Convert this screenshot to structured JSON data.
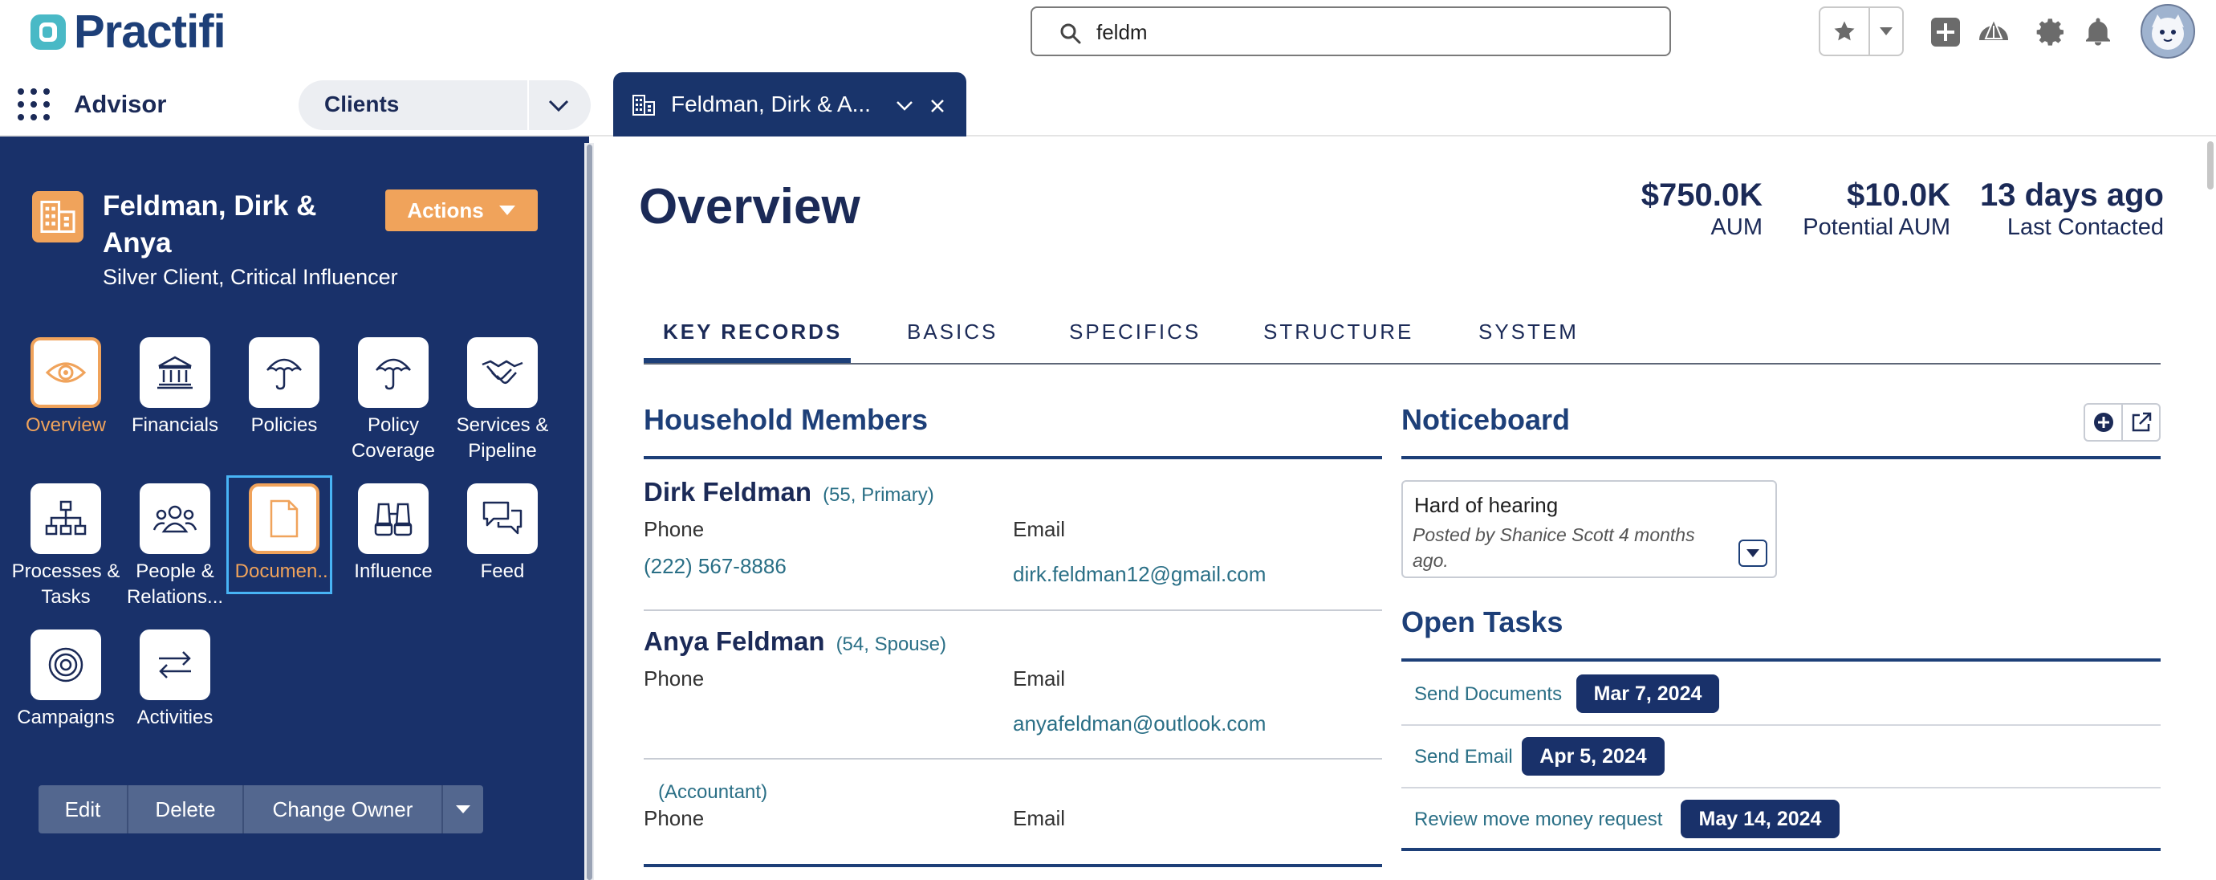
{
  "header": {
    "logo_text": "Practifi",
    "search": {
      "value": "feldm",
      "placeholder": ""
    }
  },
  "nav": {
    "app_name": "Advisor",
    "object_selector": "Clients",
    "active_tab": "Feldman, Dirk & A..."
  },
  "record": {
    "name": "Feldman, Dirk & Anya",
    "subtitle": "Silver Client, Critical Influencer",
    "actions_label": "Actions",
    "tiles": [
      {
        "label": "Overview",
        "icon": "eye-icon"
      },
      {
        "label": "Financials",
        "icon": "bank-icon"
      },
      {
        "label": "Policies",
        "icon": "umbrella-icon"
      },
      {
        "label": "Policy Coverage",
        "icon": "umbrella-icon"
      },
      {
        "label": "Services & Pipeline",
        "icon": "handshake-icon"
      },
      {
        "label": "Processes & Tasks",
        "icon": "hierarchy-icon"
      },
      {
        "label": "People & Relations...",
        "icon": "people-icon"
      },
      {
        "label": "Documen...",
        "icon": "document-icon"
      },
      {
        "label": "Influence",
        "icon": "binoculars-icon"
      },
      {
        "label": "Feed",
        "icon": "chat-icon"
      },
      {
        "label": "Campaigns",
        "icon": "target-icon"
      },
      {
        "label": "Activities",
        "icon": "swap-icon"
      }
    ],
    "buttons": {
      "edit": "Edit",
      "delete": "Delete",
      "change_owner": "Change Owner"
    }
  },
  "overview": {
    "title": "Overview",
    "stats": [
      {
        "value": "$750.0K",
        "label": "AUM"
      },
      {
        "value": "$10.0K",
        "label": "Potential AUM"
      },
      {
        "value": "13 days ago",
        "label": "Last Contacted"
      }
    ],
    "tabs": [
      "KEY RECORDS",
      "BASICS",
      "SPECIFICS",
      "STRUCTURE",
      "SYSTEM"
    ],
    "active_tab": "KEY RECORDS"
  },
  "household": {
    "title": "Household Members",
    "phone_label": "Phone",
    "email_label": "Email",
    "members": [
      {
        "name": "Dirk Feldman",
        "meta": "(55, Primary)",
        "phone": "(222) 567-8886",
        "email": "dirk.feldman12@gmail.com"
      },
      {
        "name": "Anya Feldman",
        "meta": "(54, Spouse)",
        "phone": "",
        "email": "anyafeldman@outlook.com"
      },
      {
        "name": "",
        "meta": "(Accountant)",
        "phone": "",
        "email": ""
      }
    ]
  },
  "noticeboard": {
    "title": "Noticeboard",
    "note_title": "Hard of hearing",
    "note_posted": "Posted by Shanice Scott 4 months ago."
  },
  "tasks": {
    "title": "Open Tasks",
    "items": [
      {
        "name": "Send Documents",
        "date": "Mar 7, 2024"
      },
      {
        "name": "Send Email",
        "date": "Apr 5, 2024"
      },
      {
        "name": "Review move money request",
        "date": "May 14, 2024"
      }
    ]
  },
  "colors": {
    "navy": "#19316a",
    "accent_orange": "#f0a35b",
    "link_teal": "#2a6f86",
    "selection_blue": "#48b4f5"
  }
}
